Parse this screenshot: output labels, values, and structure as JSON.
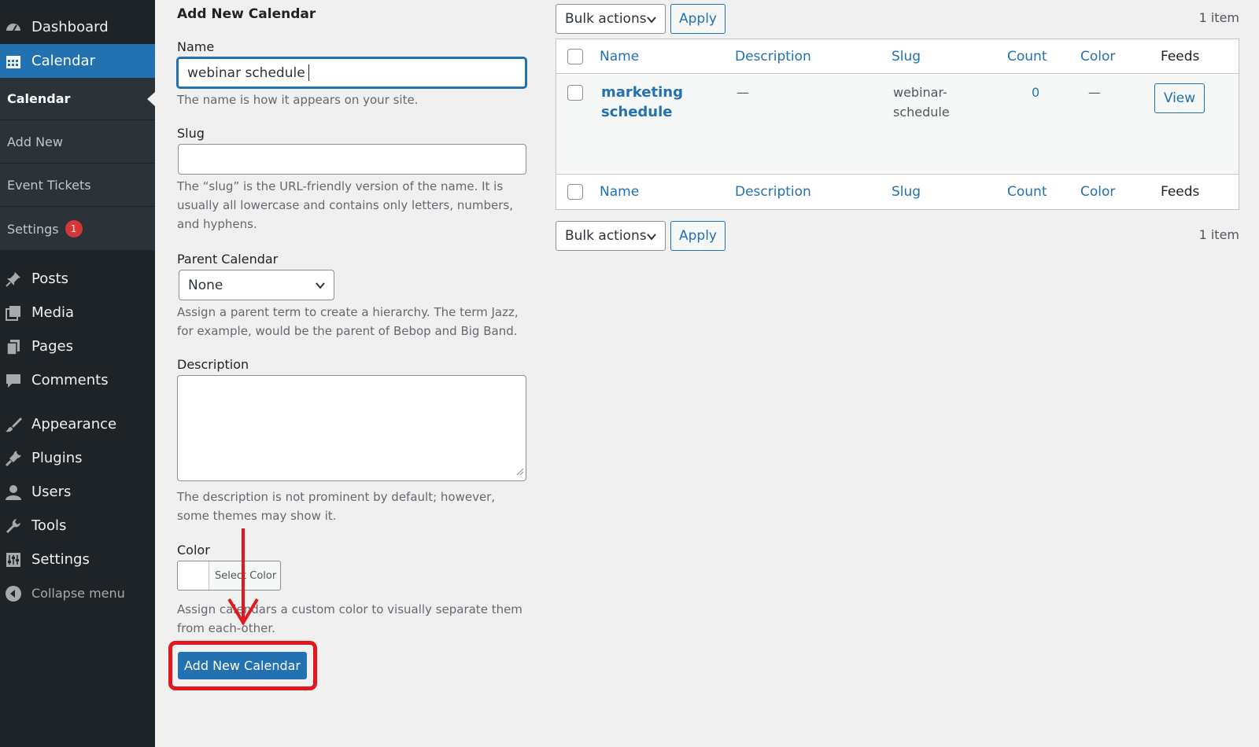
{
  "sidebar": {
    "menu": {
      "dashboard": "Dashboard",
      "calendar": "Calendar",
      "posts": "Posts",
      "media": "Media",
      "pages": "Pages",
      "comments": "Comments",
      "appearance": "Appearance",
      "plugins": "Plugins",
      "users": "Users",
      "tools": "Tools",
      "settings": "Settings",
      "collapse": "Collapse menu"
    },
    "submenu": {
      "calendar": "Calendar",
      "add_new": "Add New",
      "event_tickets": "Event Tickets",
      "settings": "Settings",
      "settings_badge": "1"
    }
  },
  "form": {
    "heading": "Add New Calendar",
    "name_label": "Name",
    "name_value": "webinar schedule",
    "name_help": "The name is how it appears on your site.",
    "slug_label": "Slug",
    "slug_value": "",
    "slug_help": "The “slug” is the URL-friendly version of the name. It is usually all lowercase and contains only letters, numbers, and hyphens.",
    "parent_label": "Parent Calendar",
    "parent_value": "None",
    "parent_help": "Assign a parent term to create a hierarchy. The term Jazz, for example, would be the parent of Bebop and Big Band.",
    "description_label": "Description",
    "description_help": "The description is not prominent by default; however, some themes may show it.",
    "color_label": "Color",
    "color_button": "Select Color",
    "color_help": "Assign calendars a custom color to visually separate them from each-other.",
    "submit": "Add New Calendar"
  },
  "table": {
    "bulk_label": "Bulk actions",
    "apply_label": "Apply",
    "item_count": "1 item",
    "columns": [
      "Name",
      "Description",
      "Slug",
      "Count",
      "Color",
      "Feeds"
    ],
    "rows": [
      {
        "name": "marketing schedule",
        "description": "—",
        "slug": "webinar-schedule",
        "count": "0",
        "color": "—",
        "feeds": "View"
      }
    ]
  },
  "colors": {
    "sidebar_bg": "#1d2327",
    "accent": "#2271b1",
    "highlight": "#e3181f",
    "badge": "#d63638"
  }
}
